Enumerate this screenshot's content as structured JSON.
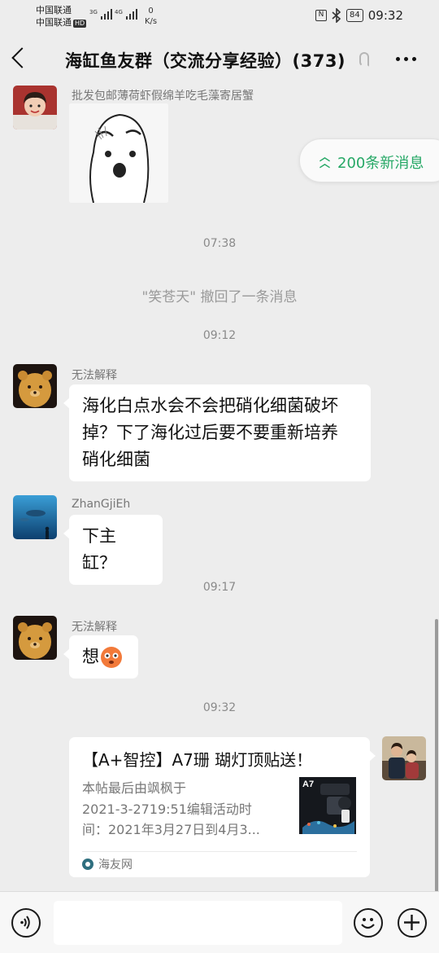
{
  "status_bar": {
    "carrier1": "中国联通",
    "carrier2": "中国联通",
    "hd_badge": "HD",
    "signal1_type": "3G",
    "signal2_type": "4G",
    "net_speed_value": "0",
    "net_speed_unit": "K/s",
    "nfc_label": "N",
    "bluetooth_icon": "bluetooth-icon",
    "battery_level": "84",
    "time": "09:32"
  },
  "header": {
    "title": "海缸鱼友群（交流分享经验）(373)",
    "back_icon": "chevron-left-icon",
    "mute_icon": "ear-icon",
    "more_icon": "more-dots-icon"
  },
  "new_messages": {
    "label": "200条新消息",
    "icon": "double-chevron-up-icon",
    "color": "#26a866"
  },
  "messages": [
    {
      "type": "sticker",
      "sender": "批发包邮薄荷虾假绵羊吃毛藻寄居蟹"
    },
    {
      "type": "time",
      "text": "07:38"
    },
    {
      "type": "system",
      "text": "\"笑苍天\" 撤回了一条消息"
    },
    {
      "type": "time",
      "text": "09:12"
    },
    {
      "type": "text",
      "sender": "无法解释",
      "lines": [
        "海化白点水会不会把硝化细菌破坏",
        "掉？下了海化过后要不要重新培养",
        "硝化细菌"
      ]
    },
    {
      "type": "text",
      "sender": "ZhanGjiEh",
      "text": "下主缸？"
    },
    {
      "type": "time",
      "text": "09:17"
    },
    {
      "type": "text",
      "sender": "无法解释",
      "text": "想",
      "emoji": "scared-face-emoji"
    },
    {
      "type": "time",
      "text": "09:32"
    },
    {
      "type": "link_card",
      "title": "【A+智控】A7珊 瑚灯顶贴送！",
      "desc_lines": [
        "本帖最后由飒枫于",
        "2021-3-2719:51编辑活动时",
        "间：2021年3月27日到4月3..."
      ],
      "thumb_label": "A7",
      "source": "海友网"
    }
  ],
  "input_bar": {
    "voice_icon": "voice-icon",
    "emoji_icon": "smiley-icon",
    "plus_icon": "plus-icon"
  },
  "colors": {
    "background": "#ededed",
    "bubble": "#ffffff",
    "accent_green": "#26a866"
  }
}
